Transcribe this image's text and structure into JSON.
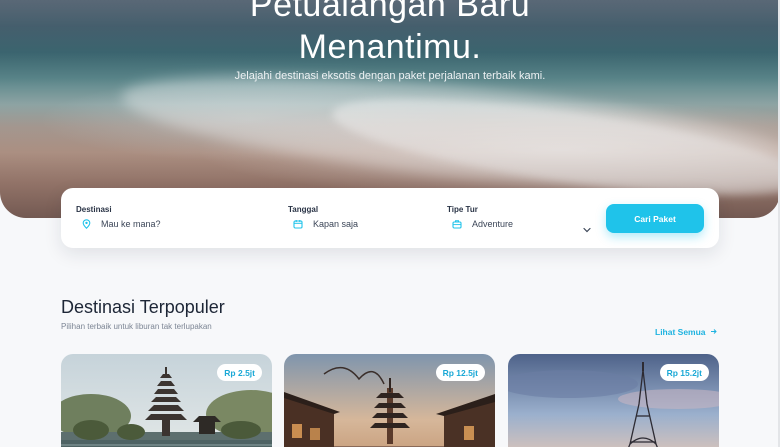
{
  "hero": {
    "title_line1": "Petualangan Baru",
    "title_line2": "Menantimu.",
    "subtitle": "Jelajahi destinasi eksotis dengan paket perjalanan terbaik kami."
  },
  "search": {
    "destination": {
      "label": "Destinasi",
      "placeholder": "Mau ke mana?",
      "icon": "map-pin-icon"
    },
    "date": {
      "label": "Tanggal",
      "placeholder": "Kapan saja",
      "icon": "calendar-icon"
    },
    "tour_type": {
      "label": "Tipe Tur",
      "selected": "Adventure",
      "icon": "suitcase-icon"
    },
    "submit_label": "Cari Paket",
    "accent_color": "#1fc3ea"
  },
  "popular": {
    "title": "Destinasi Terpopuler",
    "subtitle": "Pilihan terbaik untuk liburan tak terlupakan",
    "see_all": "Lihat Semua",
    "cards": [
      {
        "price": "Rp 2.5jt",
        "scene": "bali-temple"
      },
      {
        "price": "Rp 12.5jt",
        "scene": "kyoto-pagoda"
      },
      {
        "price": "Rp 15.2jt",
        "scene": "paris-eiffel"
      }
    ]
  }
}
